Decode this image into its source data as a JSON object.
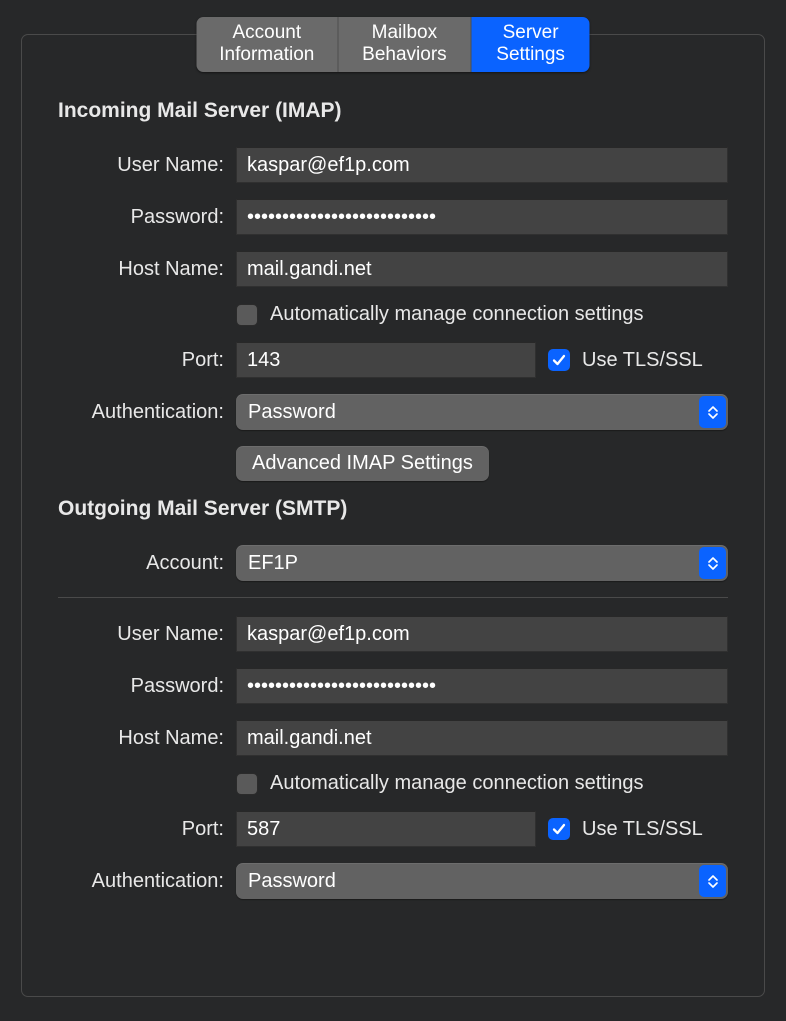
{
  "tabs": {
    "account_info": "Account Information",
    "mailbox_behaviors": "Mailbox Behaviors",
    "server_settings": "Server Settings"
  },
  "incoming": {
    "title": "Incoming Mail Server (IMAP)",
    "labels": {
      "username": "User Name:",
      "password": "Password:",
      "hostname": "Host Name:",
      "port": "Port:",
      "auth": "Authentication:"
    },
    "username": "kaspar@ef1p.com",
    "password_mask": "•••••••••••••••••••••••••••",
    "hostname": "mail.gandi.net",
    "auto_manage_label": "Automatically manage connection settings",
    "port": "143",
    "use_tls_label": "Use TLS/SSL",
    "auth": "Password",
    "advanced_btn": "Advanced IMAP Settings"
  },
  "outgoing": {
    "title": "Outgoing Mail Server (SMTP)",
    "labels": {
      "account": "Account:",
      "username": "User Name:",
      "password": "Password:",
      "hostname": "Host Name:",
      "port": "Port:",
      "auth": "Authentication:"
    },
    "account": "EF1P",
    "username": "kaspar@ef1p.com",
    "password_mask": "•••••••••••••••••••••••••••",
    "hostname": "mail.gandi.net",
    "auto_manage_label": "Automatically manage connection settings",
    "port": "587",
    "use_tls_label": "Use TLS/SSL",
    "auth": "Password"
  }
}
